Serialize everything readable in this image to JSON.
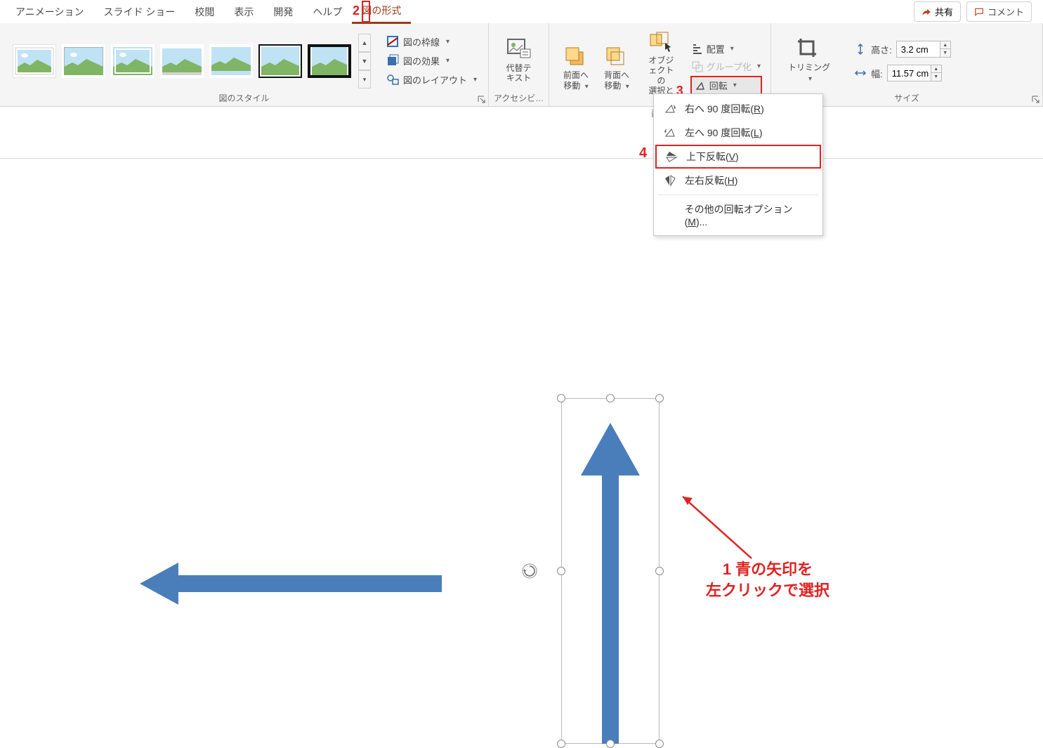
{
  "colors": {
    "accent": "#c43e1c",
    "highlight": "#e02222",
    "arrow_blue": "#4a7ebb"
  },
  "tabs": {
    "animation": "アニメーション",
    "slideshow": "スライド ショー",
    "review": "校閲",
    "view": "表示",
    "developer": "開発",
    "help": "ヘルプ",
    "picture_format": "図の形式"
  },
  "topright": {
    "share": "共有",
    "comment": "コメント"
  },
  "ribbon": {
    "styles_group": "図のスタイル",
    "pic_border": "図の枠線",
    "pic_effects": "図の効果",
    "pic_layout": "図のレイアウト",
    "accessibility_group": "アクセシビ…",
    "alt_text": "代替テ\nキスト",
    "arrange_group": "配置",
    "bring_forward": "前面へ\n移動",
    "send_backward": "背面へ\n移動",
    "selection_pane": "オブジェクトの\n選択と表示",
    "align": "配置",
    "group": "グループ化",
    "rotate": "回転",
    "size_group": "サイズ",
    "crop": "トリミング",
    "height_label": "高さ:",
    "width_label": "幅:",
    "height_value": "3.2 cm",
    "width_value": "11.57 cm"
  },
  "rotate_menu": {
    "right90": "右へ 90 度回転(",
    "right90_k": "R",
    "right90_end": ")",
    "left90": "左へ 90 度回転(",
    "left90_k": "L",
    "left90_end": ")",
    "flipv": "上下反転(",
    "flipv_k": "V",
    "flipv_end": ")",
    "fliph": "左右反転(",
    "fliph_k": "H",
    "fliph_end": ")",
    "more": "その他の回転オプション(",
    "more_k": "M",
    "more_end": ")..."
  },
  "callouts": {
    "n2": "2",
    "n3": "3",
    "n4": "4",
    "bottom_line1": "1 青の矢印を",
    "bottom_line2": "左クリックで選択"
  }
}
